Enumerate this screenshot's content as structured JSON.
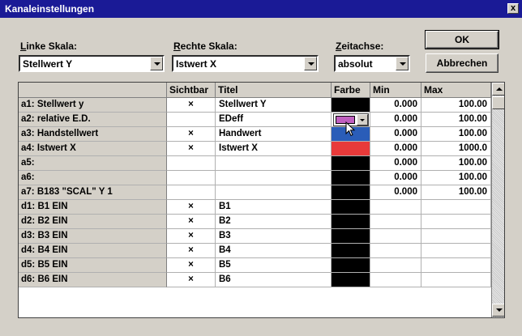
{
  "window": {
    "title": "Kanaleinstellungen",
    "close_label": "x"
  },
  "labels": {
    "left_scale": {
      "mnemonic": "L",
      "rest": "inke Skala:"
    },
    "right_scale": {
      "mnemonic": "R",
      "rest": "echte Skala:"
    },
    "time_axis": {
      "mnemonic": "Z",
      "rest": "eitachse:"
    }
  },
  "combos": {
    "left_scale": "Stellwert Y",
    "right_scale": "Istwert X",
    "time_axis": "absolut"
  },
  "buttons": {
    "ok": "OK",
    "cancel": "Abbrechen"
  },
  "table": {
    "headers": {
      "name": "",
      "visible": "Sichtbar",
      "title": "Titel",
      "color": "Farbe",
      "min": "Min",
      "max": "Max"
    },
    "rows": [
      {
        "name": "a1: Stellwert y",
        "visible": "×",
        "title": "Stellwert Y",
        "color": "#000000",
        "min": "0.000",
        "max": "100.00"
      },
      {
        "name": "a2: relative E.D.",
        "visible": "",
        "title": "EDeff",
        "color": "#c060c0",
        "min": "0.000",
        "max": "100.00"
      },
      {
        "name": "a3: Handstellwert",
        "visible": "×",
        "title": "Handwert",
        "color": "#2a5db8",
        "min": "0.000",
        "max": "100.00"
      },
      {
        "name": "a4: Istwert X",
        "visible": "×",
        "title": "Istwert X",
        "color": "#e83a3a",
        "min": "0.000",
        "max": "1000.0"
      },
      {
        "name": "a5:",
        "visible": "",
        "title": "",
        "color": "#000000",
        "min": "0.000",
        "max": "100.00"
      },
      {
        "name": "a6:",
        "visible": "",
        "title": "",
        "color": "#000000",
        "min": "0.000",
        "max": "100.00"
      },
      {
        "name": "a7: B183 \"SCAL\" Y 1",
        "visible": "",
        "title": "",
        "color": "#000000",
        "min": "0.000",
        "max": "100.00"
      },
      {
        "name": "d1: B1 EIN",
        "visible": "×",
        "title": "B1",
        "color": "#000000",
        "min": "",
        "max": ""
      },
      {
        "name": "d2: B2 EIN",
        "visible": "×",
        "title": "B2",
        "color": "#000000",
        "min": "",
        "max": ""
      },
      {
        "name": "d3: B3 EIN",
        "visible": "×",
        "title": "B3",
        "color": "#000000",
        "min": "",
        "max": ""
      },
      {
        "name": "d4: B4 EIN",
        "visible": "×",
        "title": "B4",
        "color": "#000000",
        "min": "",
        "max": ""
      },
      {
        "name": "d5: B5 EIN",
        "visible": "×",
        "title": "B5",
        "color": "#000000",
        "min": "",
        "max": ""
      },
      {
        "name": "d6: B6 EIN",
        "visible": "×",
        "title": "B6",
        "color": "#000000",
        "min": "",
        "max": ""
      }
    ]
  },
  "colors": {
    "titlebar": "#1a1a96",
    "dialog": "#d4d0c8"
  },
  "icons": {
    "close": "close-icon",
    "dropdown": "chevron-down-icon",
    "cursor": "mouse-pointer-icon"
  }
}
